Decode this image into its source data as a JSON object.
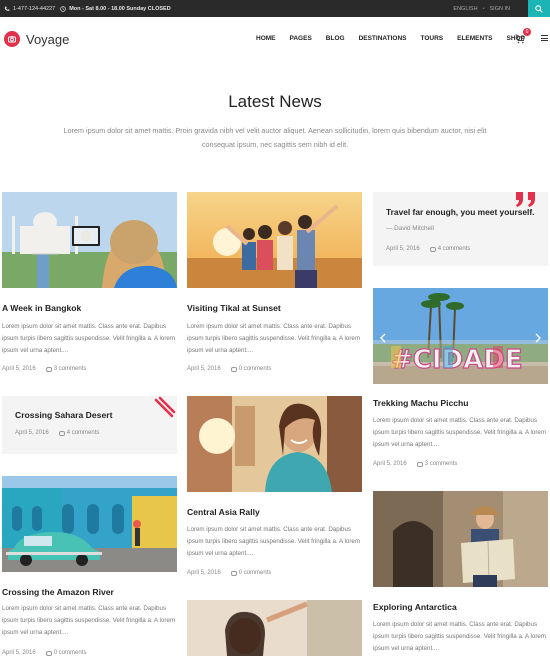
{
  "topbar": {
    "phone": "1-477-124-44227",
    "hours": "Mon - Sat 8.00 - 18.00 Sunday CLOSED",
    "language": "ENGLISH",
    "signin": "SIGN IN"
  },
  "header": {
    "logo_text": "Voyage",
    "nav": [
      "HOME",
      "PAGES",
      "BLOG",
      "DESTINATIONS",
      "TOURS",
      "ELEMENTS",
      "SHOP"
    ],
    "cart_count": "0"
  },
  "section": {
    "title": "Latest News",
    "intro": "Lorem ipsum dolor sit amet mattis. Proin gravida nibh vel velit auctor aliquet. Aenean sollicitudin, lorem quis bibendum auctor, nisi elit consequat ipsum, nec sagittis sem nibh id elit."
  },
  "excerpt_text": "Lorem ipsum dolor sit amet mattis. Class ante erat. Dapibus ipsum turpis libero sagittis suspendisse. Velit fringilla a. A lorem ipsum vel urna aptent....",
  "posts": {
    "bangkok": {
      "title": "A Week in Bangkok",
      "date": "April 5, 2016",
      "comments": "3 comments"
    },
    "tikal": {
      "title": "Visiting Tikal at Sunset",
      "date": "April 5, 2016",
      "comments": "0 comments"
    },
    "quote": {
      "title": "Travel far enough, you meet yourself.",
      "author": "— David Mitchell",
      "date": "April 5, 2016",
      "comments": "4 comments"
    },
    "machu": {
      "title": "Trekking Machu Picchu",
      "date": "April 5, 2016",
      "comments": "3 comments"
    },
    "sahara": {
      "title": "Crossing Sahara Desert",
      "date": "April 5, 2016",
      "comments": "4 comments"
    },
    "asia": {
      "title": "Central Asia Rally",
      "date": "April 5, 2016",
      "comments": "0 comments"
    },
    "amazon": {
      "title": "Crossing the Amazon River",
      "date": "April 5, 2016",
      "comments": "0 comments"
    },
    "antarctica": {
      "title": "Exploring Antarctica",
      "date": "April 5, 2016",
      "comments": "0 comments"
    }
  },
  "slider_text": "#CIDADE",
  "colors": {
    "accent": "#e1314c",
    "search": "#1bb5b5",
    "topbar": "#2a2a2a"
  }
}
